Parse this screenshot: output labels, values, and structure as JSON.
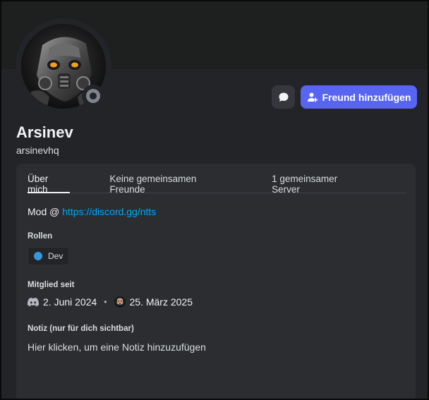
{
  "profile": {
    "display_name": "Arsinev",
    "username": "arsinevhq",
    "status": "offline"
  },
  "actions": {
    "message_icon": "chat-bubble-icon",
    "add_friend_label": "Freund hinzufügen",
    "add_friend_icon": "person-add-icon"
  },
  "tabs": [
    {
      "label": "Über mich",
      "active": true
    },
    {
      "label": "Keine gemeinsamen Freunde",
      "active": false
    },
    {
      "label": "1 gemeinsamer Server",
      "active": false
    }
  ],
  "about": {
    "prefix": "Mod @ ",
    "link": "https://discord.gg/ntts"
  },
  "roles": {
    "title": "Rollen",
    "items": [
      {
        "name": "Dev",
        "color": "#3498db"
      }
    ]
  },
  "member_since": {
    "title": "Mitglied seit",
    "discord_date": "2. Juni 2024",
    "separator": "•",
    "server_date": "25. März 2025"
  },
  "note": {
    "title": "Notiz (nur für dich sichtbar)",
    "placeholder": "Hier klicken, um eine Notiz hinzuzufügen"
  },
  "colors": {
    "accent": "#5865f2",
    "link": "#00a8fc",
    "background": "#232428",
    "card": "#2b2d31"
  }
}
